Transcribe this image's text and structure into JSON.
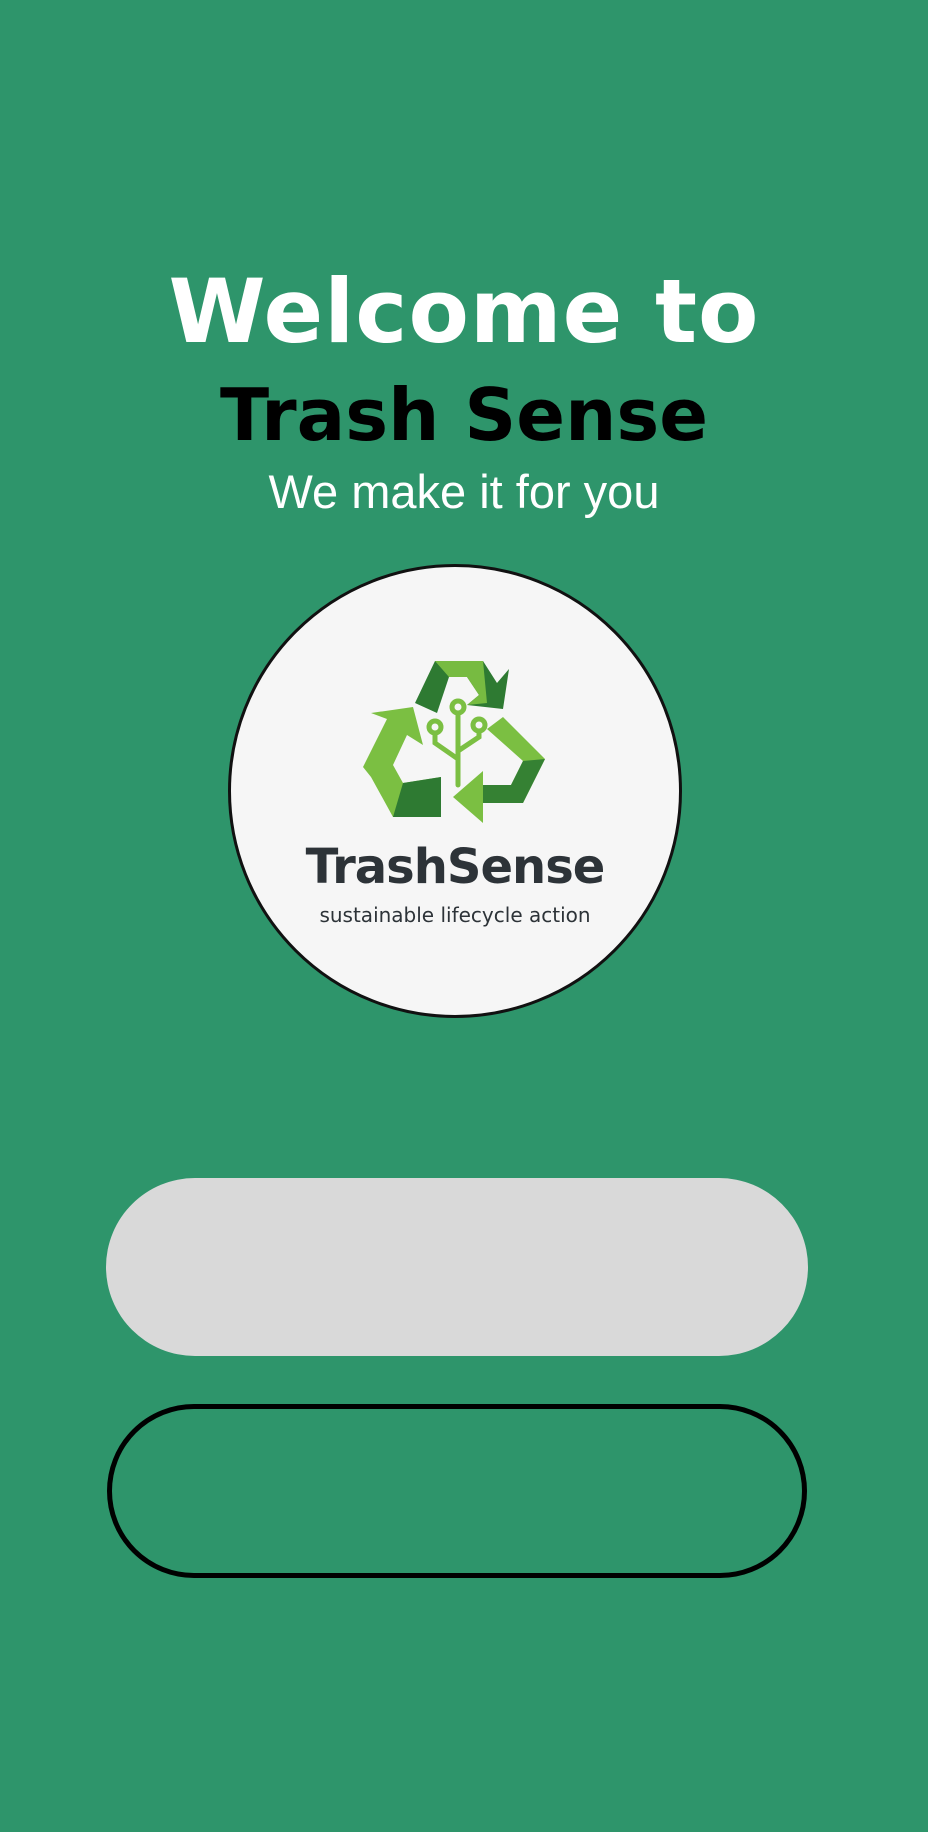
{
  "header": {
    "welcome": "Welcome to",
    "app_name": "Trash Sense",
    "tagline": "We make it for you"
  },
  "logo": {
    "icon": "recycle-circuit-icon",
    "wordmark": "TrashSense",
    "subtitle": "sustainable lifecycle action",
    "colors": {
      "dark_green": "#2e7a32",
      "light_green": "#7bbf42",
      "text": "#2d3338"
    }
  },
  "buttons": {
    "primary_label": "",
    "secondary_label": ""
  },
  "colors": {
    "background": "#2e956b",
    "primary_button": "#d9d9d9",
    "secondary_button_border": "#000000"
  }
}
